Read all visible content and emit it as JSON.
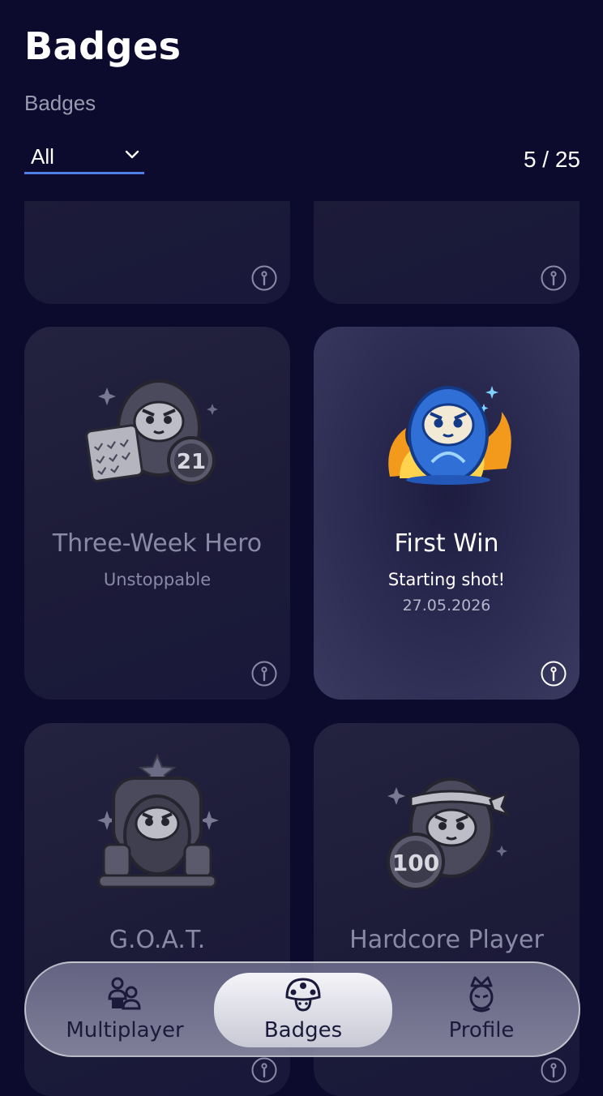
{
  "header": {
    "title": "Badges",
    "subtitle": "Badges",
    "filter": {
      "selected": "All"
    },
    "count": "5 / 25"
  },
  "badges": [
    {
      "name": "",
      "description": "",
      "date": "",
      "unlocked": false,
      "icon": "partial-badge"
    },
    {
      "name": "",
      "description": "",
      "date": "",
      "unlocked": false,
      "icon": "partial-badge"
    },
    {
      "name": "Three-Week Hero",
      "description": "Unstoppable",
      "date": "",
      "unlocked": false,
      "icon": "daruma-calendar-21-icon"
    },
    {
      "name": "First Win",
      "description": "Starting shot!",
      "date": "27.05.2026",
      "unlocked": true,
      "icon": "daruma-fire-icon"
    },
    {
      "name": "G.O.A.T.",
      "description": "",
      "date": "",
      "unlocked": false,
      "icon": "daruma-throne-icon"
    },
    {
      "name": "Hardcore Player",
      "description": "",
      "date": "",
      "unlocked": false,
      "icon": "daruma-100-icon"
    }
  ],
  "nav": {
    "items": [
      {
        "label": "Multiplayer",
        "icon": "multiplayer-icon",
        "active": false
      },
      {
        "label": "Badges",
        "icon": "mushroom-icon",
        "active": true
      },
      {
        "label": "Profile",
        "icon": "crown-profile-icon",
        "active": false
      }
    ]
  },
  "colors": {
    "background": "#0c0b2d",
    "accent": "#4f7fe6",
    "badge_blue": "#2f6fd6",
    "fire": "#f39a1c"
  }
}
